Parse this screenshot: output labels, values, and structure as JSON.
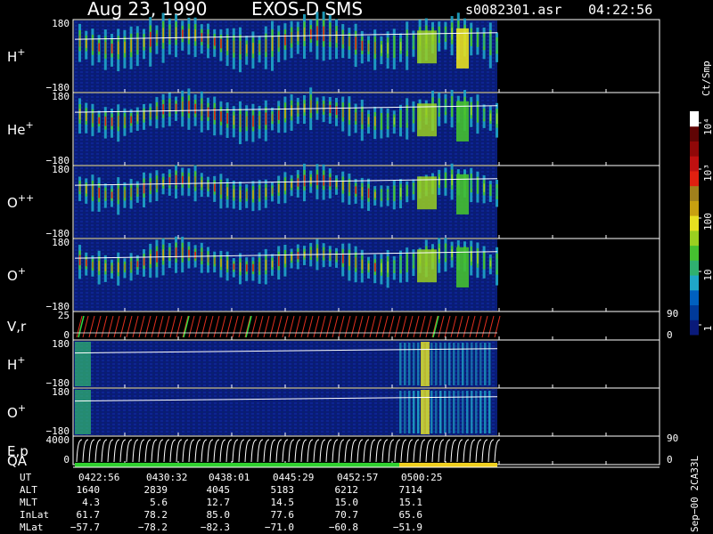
{
  "header": {
    "date": "Aug 23, 1990",
    "instrument": "EXOS-D SMS",
    "file": "s0082301.asr",
    "time": "04:22:56"
  },
  "colorbar": {
    "unit": "Ct/Smp",
    "ticks": [
      "1",
      "10",
      "100",
      "10³",
      "10⁴"
    ],
    "colors": [
      "#0a1a7a",
      "#003a9a",
      "#0060c0",
      "#1fa6c8",
      "#2fb070",
      "#45c030",
      "#9ad020",
      "#e8e020",
      "#c8a010",
      "#a0801c",
      "#e02010",
      "#c01010",
      "#900808",
      "#600404",
      "#ffffff"
    ]
  },
  "panels": [
    {
      "id": "h-plus",
      "label": "H",
      "sup": "+",
      "ticks": {
        "top": "180",
        "bottom": "−180"
      }
    },
    {
      "id": "he-plus",
      "label": "He",
      "sup": "+",
      "ticks": {
        "top": "180",
        "bottom": "−180"
      }
    },
    {
      "id": "o-plus-plus",
      "label": "O",
      "sup": "++",
      "ticks": {
        "top": "180",
        "bottom": "−180"
      }
    },
    {
      "id": "o-plus",
      "label": "O",
      "sup": "+",
      "ticks": {
        "top": "180",
        "bottom": "−180"
      }
    },
    {
      "id": "v-r",
      "label": "V,r",
      "sup": "",
      "ticks": {
        "top": "25",
        "bottom": "0"
      },
      "right_ticks": {
        "top": "90",
        "bottom": "0"
      }
    },
    {
      "id": "h-plus-2",
      "label": "H",
      "sup": "+",
      "ticks": {
        "top": "180",
        "bottom": "−180"
      }
    },
    {
      "id": "o-plus-2",
      "label": "O",
      "sup": "+",
      "ticks": {
        "top": "180",
        "bottom": "−180"
      }
    },
    {
      "id": "e-p",
      "label": "E,p",
      "sup": "",
      "ticks": {
        "top": "4000",
        "bottom": "0"
      },
      "right_ticks": {
        "top": "90",
        "bottom": "0"
      }
    }
  ],
  "qa_label": "QA",
  "qa_colors": {
    "good": "#30d030",
    "warn": "#f0d020"
  },
  "footer": {
    "rows": [
      {
        "label": "UT",
        "values": [
          "0422:56",
          "0430:32",
          "0438:01",
          "0445:29",
          "0452:57",
          "0500:25"
        ]
      },
      {
        "label": "ALT",
        "values": [
          "1640",
          "2839",
          "4045",
          "5183",
          "6212",
          "7114"
        ]
      },
      {
        "label": "MLT",
        "values": [
          "4.3",
          "5.6",
          "12.7",
          "14.5",
          "15.0",
          "15.1"
        ]
      },
      {
        "label": "InLat",
        "values": [
          "61.7",
          "78.2",
          "85.0",
          "77.6",
          "70.7",
          "65.6"
        ]
      },
      {
        "label": "MLat",
        "values": [
          "−57.7",
          "−78.2",
          "−82.3",
          "−71.0",
          "−60.8",
          "−51.9"
        ]
      }
    ],
    "side_text": "Sep−00  2CA33L"
  },
  "chart_data": {
    "type": "heatmap",
    "title": "Aug 23, 1990   EXOS-D SMS",
    "x": [
      "0422:56",
      "0430:32",
      "0438:01",
      "0445:29",
      "0452:57",
      "0500:25"
    ],
    "colorbar_ticks": [
      "1",
      "10",
      "100",
      "10³",
      "10⁴"
    ],
    "colorbar_label": "Ct/Smp",
    "series": [
      {
        "name": "H+",
        "ylim": [
          -180,
          180
        ]
      },
      {
        "name": "He+",
        "ylim": [
          -180,
          180
        ]
      },
      {
        "name": "O++",
        "ylim": [
          -180,
          180
        ]
      },
      {
        "name": "O+",
        "ylim": [
          -180,
          180
        ]
      },
      {
        "name": "V,r",
        "ylim": [
          0,
          25
        ],
        "ylim_right": [
          0,
          90
        ]
      },
      {
        "name": "H+",
        "ylim": [
          -180,
          180
        ]
      },
      {
        "name": "O+",
        "ylim": [
          -180,
          180
        ]
      },
      {
        "name": "E,p",
        "ylim": [
          0,
          4000
        ],
        "ylim_right": [
          0,
          90
        ]
      }
    ]
  }
}
